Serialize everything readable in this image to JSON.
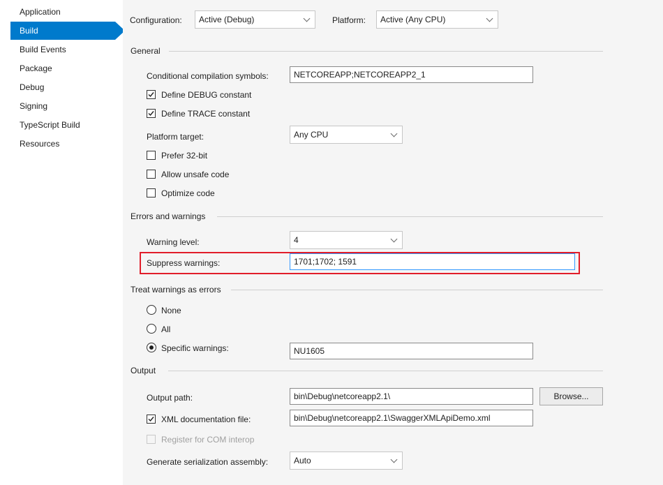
{
  "sidebar": {
    "items": [
      {
        "label": "Application"
      },
      {
        "label": "Build"
      },
      {
        "label": "Build Events"
      },
      {
        "label": "Package"
      },
      {
        "label": "Debug"
      },
      {
        "label": "Signing"
      },
      {
        "label": "TypeScript Build"
      },
      {
        "label": "Resources"
      }
    ],
    "active": "Build"
  },
  "top": {
    "configuration_label": "Configuration:",
    "configuration_value": "Active (Debug)",
    "platform_label": "Platform:",
    "platform_value": "Active (Any CPU)"
  },
  "general": {
    "header": "General",
    "symbols_label": "Conditional compilation symbols:",
    "symbols_value": "NETCOREAPP;NETCOREAPP2_1",
    "define_debug_label": "Define DEBUG constant",
    "define_debug_checked": true,
    "define_trace_label": "Define TRACE constant",
    "define_trace_checked": true,
    "platform_target_label": "Platform target:",
    "platform_target_value": "Any CPU",
    "prefer32_label": "Prefer 32-bit",
    "prefer32_checked": false,
    "unsafe_label": "Allow unsafe code",
    "unsafe_checked": false,
    "optimize_label": "Optimize code",
    "optimize_checked": false
  },
  "errors": {
    "header": "Errors and warnings",
    "warning_level_label": "Warning level:",
    "warning_level_value": "4",
    "suppress_label": "Suppress warnings:",
    "suppress_value": "1701;1702; 1591",
    "highlight_color": "#e11d2a"
  },
  "treat": {
    "header": "Treat warnings as errors",
    "none_label": "None",
    "all_label": "All",
    "specific_label": "Specific warnings:",
    "selected": "specific",
    "specific_value": "NU1605"
  },
  "output": {
    "header": "Output",
    "path_label": "Output path:",
    "path_value": "bin\\Debug\\netcoreapp2.1\\",
    "browse_label": "Browse...",
    "xml_label": "XML documentation file:",
    "xml_checked": true,
    "xml_value": "bin\\Debug\\netcoreapp2.1\\SwaggerXMLApiDemo.xml",
    "com_label": "Register for COM interop",
    "com_checked": false,
    "serial_label": "Generate serialization assembly:",
    "serial_value": "Auto"
  },
  "colors": {
    "accent": "#007acc",
    "panel_bg": "#f5f5f5"
  }
}
